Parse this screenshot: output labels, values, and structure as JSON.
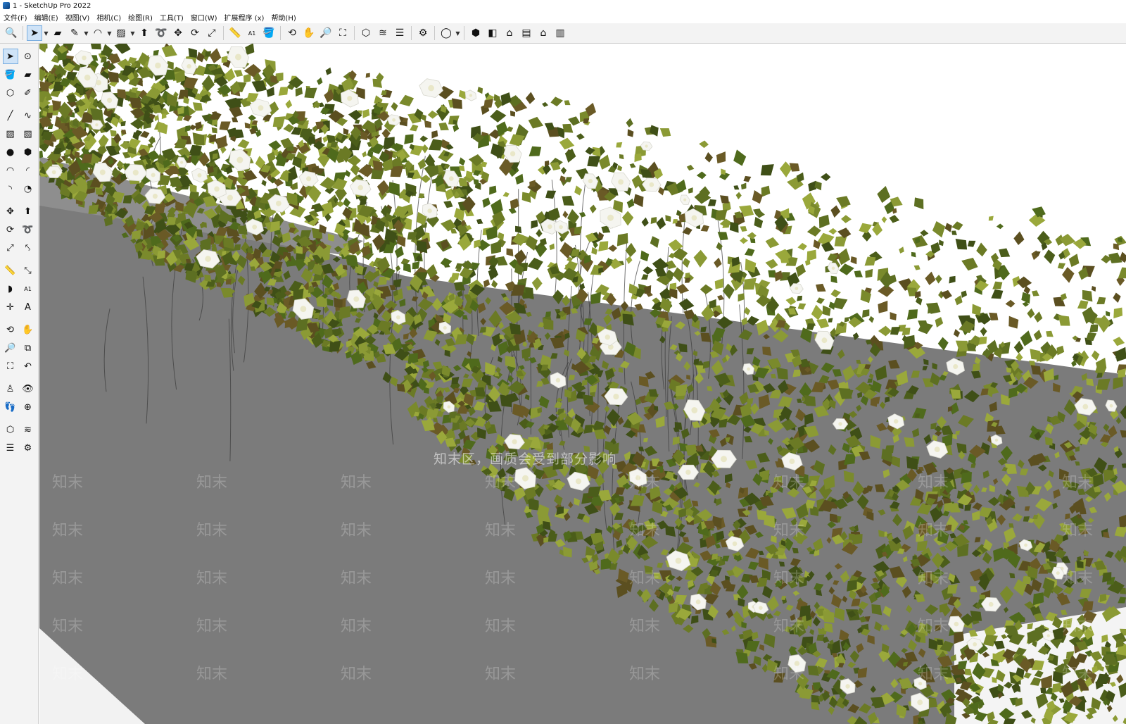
{
  "window": {
    "title": "1 - SketchUp Pro 2022"
  },
  "menu": [
    "文件(F)",
    "编辑(E)",
    "视图(V)",
    "相机(C)",
    "绘图(R)",
    "工具(T)",
    "窗口(W)",
    "扩展程序 (x)",
    "帮助(H)"
  ],
  "toolbar": {
    "groups": [
      [
        {
          "name": "search-icon",
          "glyph": "🔍"
        }
      ],
      [
        {
          "name": "select-arrow-icon",
          "glyph": "➤",
          "active": true,
          "drop": true
        },
        {
          "name": "eraser-icon",
          "glyph": "▰"
        },
        {
          "name": "pencil-line-icon",
          "glyph": "✎",
          "drop": true
        },
        {
          "name": "arc-icon",
          "glyph": "◠",
          "drop": true
        },
        {
          "name": "rectangle-icon",
          "glyph": "▨",
          "drop": true
        },
        {
          "name": "push-pull-icon",
          "glyph": "⬆"
        },
        {
          "name": "follow-me-icon",
          "glyph": "➰"
        },
        {
          "name": "move-icon",
          "glyph": "✥"
        },
        {
          "name": "rotate-icon",
          "glyph": "⟳"
        },
        {
          "name": "scale-icon",
          "glyph": "⤢"
        }
      ],
      [
        {
          "name": "tape-measure-icon",
          "glyph": "📏"
        },
        {
          "name": "text-label-icon",
          "glyph": "A1"
        },
        {
          "name": "paint-bucket-icon",
          "glyph": "🪣"
        }
      ],
      [
        {
          "name": "orbit-icon",
          "glyph": "⟲"
        },
        {
          "name": "pan-icon",
          "glyph": "✋"
        },
        {
          "name": "zoom-icon",
          "glyph": "🔎"
        },
        {
          "name": "zoom-extents-icon",
          "glyph": "⛶"
        }
      ],
      [
        {
          "name": "warehouse-icon",
          "glyph": "⬡"
        },
        {
          "name": "extension-warehouse-icon",
          "glyph": "≋"
        },
        {
          "name": "layout-icon",
          "glyph": "☰"
        }
      ],
      [
        {
          "name": "extension-manager-icon",
          "glyph": "⚙"
        }
      ],
      [
        {
          "name": "user-account-icon",
          "glyph": "◯",
          "drop": true
        }
      ],
      [
        {
          "name": "iso-view-icon",
          "glyph": "⬢"
        },
        {
          "name": "top-view-icon",
          "glyph": "◧"
        },
        {
          "name": "front-view-icon",
          "glyph": "⌂"
        },
        {
          "name": "right-view-icon",
          "glyph": "▤"
        },
        {
          "name": "back-view-icon",
          "glyph": "⌂"
        },
        {
          "name": "left-view-icon",
          "glyph": "▥"
        }
      ]
    ]
  },
  "palette": [
    [
      {
        "name": "select-arrow-icon",
        "glyph": "➤",
        "active": true
      },
      {
        "name": "lasso-icon",
        "glyph": "⊙"
      }
    ],
    [
      {
        "name": "paint-bucket-icon",
        "glyph": "🪣"
      },
      {
        "name": "eraser-icon",
        "glyph": "▰"
      }
    ],
    [
      {
        "name": "component-icon",
        "glyph": "⬡"
      },
      {
        "name": "tag-icon",
        "glyph": "✐"
      }
    ],
    "gap",
    [
      {
        "name": "pencil-line-icon",
        "glyph": "╱"
      },
      {
        "name": "freehand-icon",
        "glyph": "∿"
      }
    ],
    [
      {
        "name": "rectangle-icon",
        "glyph": "▨"
      },
      {
        "name": "rotated-rect-icon",
        "glyph": "▧"
      }
    ],
    [
      {
        "name": "circle-icon",
        "glyph": "●"
      },
      {
        "name": "polygon-icon",
        "glyph": "⬢"
      }
    ],
    [
      {
        "name": "arc-icon",
        "glyph": "◠"
      },
      {
        "name": "two-point-arc-icon",
        "glyph": "◜"
      }
    ],
    [
      {
        "name": "three-point-arc-icon",
        "glyph": "◝"
      },
      {
        "name": "pie-icon",
        "glyph": "◔"
      }
    ],
    "gap",
    [
      {
        "name": "move-icon",
        "glyph": "✥"
      },
      {
        "name": "push-pull-icon",
        "glyph": "⬆"
      }
    ],
    [
      {
        "name": "rotate-icon",
        "glyph": "⟳"
      },
      {
        "name": "follow-me-icon",
        "glyph": "➰"
      }
    ],
    [
      {
        "name": "scale-icon",
        "glyph": "⤢"
      },
      {
        "name": "offset-icon",
        "glyph": "⤣"
      }
    ],
    "gap",
    [
      {
        "name": "tape-measure-icon",
        "glyph": "📏"
      },
      {
        "name": "dimension-icon",
        "glyph": "⤡"
      }
    ],
    [
      {
        "name": "protractor-icon",
        "glyph": "◗"
      },
      {
        "name": "text-label-icon",
        "glyph": "A1"
      }
    ],
    [
      {
        "name": "axes-icon",
        "glyph": "✛"
      },
      {
        "name": "3d-text-icon",
        "glyph": "A"
      }
    ],
    "gap",
    [
      {
        "name": "orbit-icon",
        "glyph": "⟲"
      },
      {
        "name": "pan-icon",
        "glyph": "✋"
      }
    ],
    [
      {
        "name": "zoom-icon",
        "glyph": "🔎"
      },
      {
        "name": "zoom-window-icon",
        "glyph": "⧉"
      }
    ],
    [
      {
        "name": "zoom-extents-icon",
        "glyph": "⛶"
      },
      {
        "name": "previous-view-icon",
        "glyph": "↶"
      }
    ],
    "gap",
    [
      {
        "name": "position-camera-icon",
        "glyph": "♙"
      },
      {
        "name": "look-around-icon",
        "glyph": "👁"
      }
    ],
    [
      {
        "name": "walk-icon",
        "glyph": "👣"
      },
      {
        "name": "section-plane-icon",
        "glyph": "⊕"
      }
    ],
    "gap",
    [
      {
        "name": "warehouse-icon",
        "glyph": "⬡"
      },
      {
        "name": "extension-warehouse-icon",
        "glyph": "≋"
      }
    ],
    [
      {
        "name": "layout-icon",
        "glyph": "☰"
      },
      {
        "name": "extension-manager-icon",
        "glyph": "⚙"
      }
    ]
  ],
  "viewport": {
    "watermark_text": "知末区，画质会受到部分影响",
    "watermark_tile": "知末",
    "colors": {
      "background": "#ffffff",
      "wall": "#7c7c7c",
      "foliage": "#556a21",
      "flower": "#f6f6f2"
    }
  }
}
